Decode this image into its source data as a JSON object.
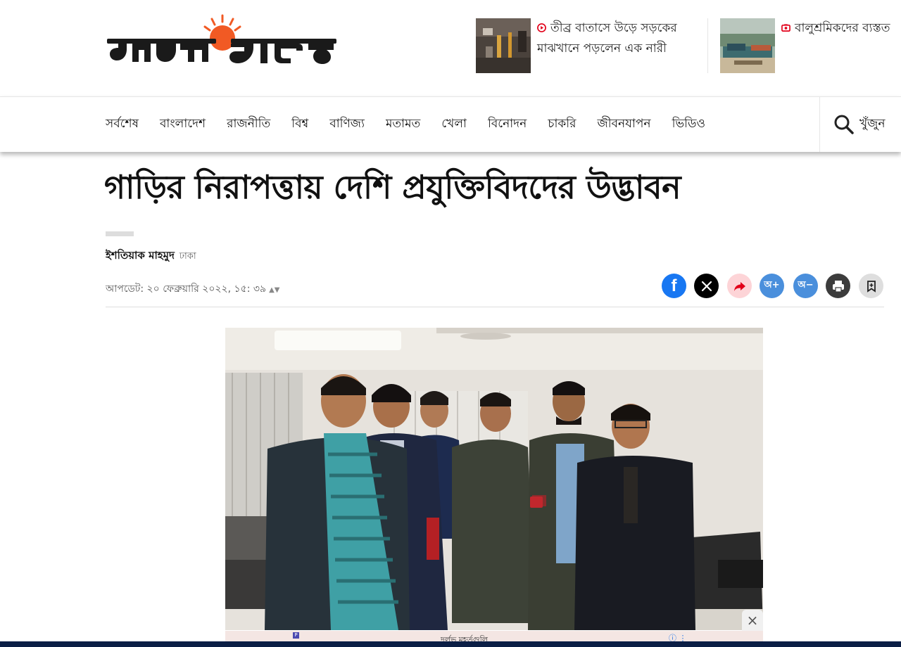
{
  "site": {
    "logo_text": "প্রথম আলো",
    "brand_color": "#e63329",
    "sun_color": "#f15a24"
  },
  "headlines": [
    {
      "text": "তীব্র বাতাসে উড়ে সড়কের মাঝখানে পড়লেন এক নারী",
      "icon": "video-play-icon"
    },
    {
      "text": "বালুশ্রমিকদের ব্যস্তত",
      "icon": "photo-icon"
    }
  ],
  "nav": {
    "items": [
      "সর্বশেষ",
      "বাংলাদেশ",
      "রাজনীতি",
      "বিশ্ব",
      "বাণিজ্য",
      "মতামত",
      "খেলা",
      "বিনোদন",
      "চাকরি",
      "জীবনযাপন",
      "ভিডিও"
    ],
    "search_label": "খুঁজুন"
  },
  "article": {
    "title": "গাড়ির নিরাপত্তায় দেশি প্রযুক্তিবিদদের উদ্ভাবন",
    "author": "ইশতিয়াক মাহমুদ",
    "location": "ঢাকা",
    "updated": "আপডেট: ২০ ফেব্রুয়ারি ২০২২, ১৫: ৩৯"
  },
  "share": {
    "facebook_glyph": "f",
    "font_plus": "অ+",
    "font_minus": "অ−"
  },
  "ad": {
    "text": "দুর্লভ মুহূর্তগুলি",
    "info": "ⓘ ⋮",
    "close": "×",
    "badge": "P"
  },
  "colors": {
    "accent": "#1877f2",
    "font_btn": "#4a8fdc",
    "footer": "#0b1e45"
  }
}
